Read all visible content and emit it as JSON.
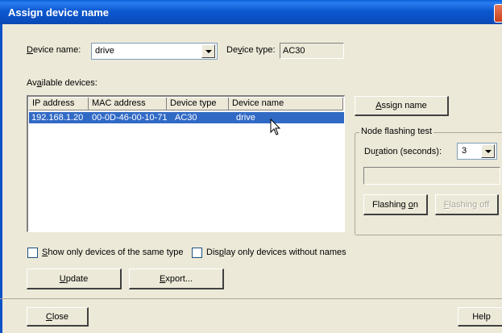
{
  "window": {
    "title": "Assign device name"
  },
  "device_name": {
    "label_prefix": "D",
    "label_rest": "evice name:",
    "value": "drive"
  },
  "device_type": {
    "label_prefix": "De",
    "label_u": "v",
    "label_rest": "ice type:",
    "value": "AC30"
  },
  "available_devices": {
    "label_prefix": "Av",
    "label_u": "a",
    "label_rest": "ilable devices:",
    "columns": [
      "IP address",
      "MAC address",
      "Device type",
      "Device name"
    ],
    "rows": [
      {
        "ip": "192.168.1.20",
        "mac": "00-0D-46-00-10-71",
        "type": "AC30",
        "name": "drive"
      }
    ]
  },
  "assign_button": {
    "u": "A",
    "rest": "ssign name"
  },
  "flashing": {
    "group_label": "Node flashing test",
    "duration_prefix": "Du",
    "duration_u": "r",
    "duration_rest": "ation (seconds):",
    "duration_value": "3",
    "on_prefix": "Flashing ",
    "on_u": "o",
    "on_rest": "n",
    "off_u": "F",
    "off_rest": "lashing off"
  },
  "filters": {
    "same_type_u": "S",
    "same_type_rest": "how only devices of the same type",
    "no_names_prefix": "Dis",
    "no_names_u": "p",
    "no_names_rest": "lay only devices without names"
  },
  "update_button": {
    "u": "U",
    "rest": "pdate"
  },
  "export_button": {
    "u": "E",
    "rest": "xport..."
  },
  "close_button": {
    "u": "C",
    "rest": "lose"
  },
  "help_button": {
    "label": "Help"
  }
}
